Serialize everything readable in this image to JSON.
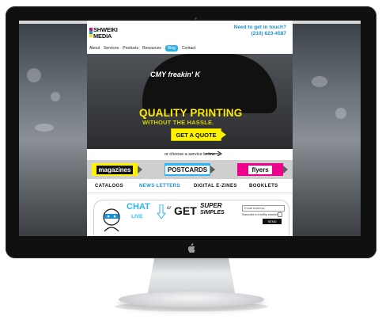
{
  "site": {
    "logo": {
      "line1": "SHWEIKI",
      "line2": "MEDIA"
    },
    "contact": {
      "heading": "Need to get in touch?",
      "phone": "(210) 623-4587"
    },
    "nav": [
      {
        "label": "About"
      },
      {
        "label": "Services"
      },
      {
        "label": "Products"
      },
      {
        "label": "Resources"
      },
      {
        "label": "Blog"
      },
      {
        "label": "Contact"
      }
    ],
    "hero": {
      "shirt_text": "CMY freakin' K",
      "headline": "QUALITY PRINTING",
      "subheadline": "WITHOUT THE HASSLE.",
      "cta": "GET A QUOTE"
    },
    "choose_text": "or choose a service below",
    "services": [
      {
        "label": "magazines"
      },
      {
        "label": "POSTCARDS"
      },
      {
        "label": "flyers"
      }
    ],
    "subservices": [
      {
        "label": "CATALOGS"
      },
      {
        "label": "NEWS LETTERS"
      },
      {
        "label": "DIGITAL E-ZINES"
      },
      {
        "label": "BOOKLETS"
      }
    ],
    "promo": {
      "chat": "CHAT",
      "live": "LIVE",
      "or": "or",
      "get": "GET",
      "super": "SUPER",
      "simples": "SIMPLES"
    },
    "newsletter": {
      "email_placeholder": "Email Address",
      "subscribe_label": "Subscribe to free/flip newsletter",
      "send": "SEND"
    }
  },
  "colors": {
    "brand_blue": "#1b8fd4",
    "yellow": "#fff200",
    "magenta": "#ec008c",
    "cyan": "#29b6f6"
  }
}
